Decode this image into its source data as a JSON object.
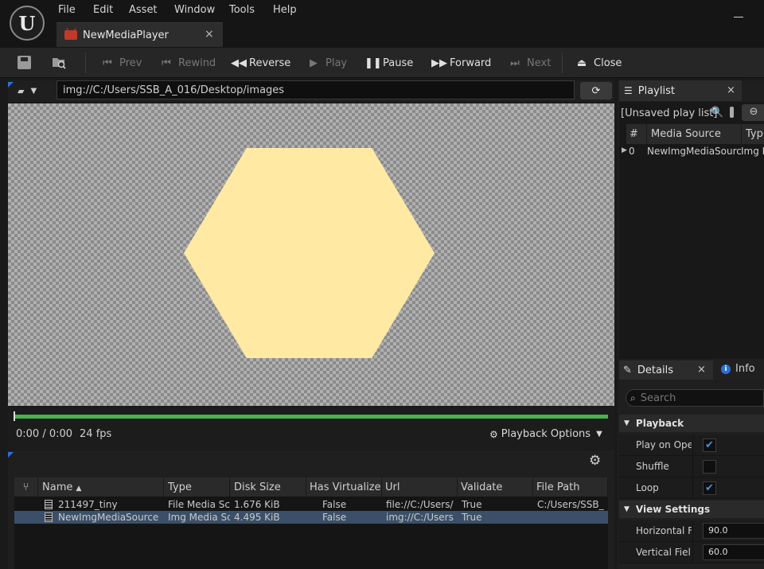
{
  "menu": [
    "File",
    "Edit",
    "Asset",
    "Window",
    "Tools",
    "Help"
  ],
  "doc_tab": {
    "title": "NewMediaPlayer",
    "close": "×"
  },
  "toolbar": {
    "prev": "Prev",
    "rewind": "Rewind",
    "reverse": "Reverse",
    "play": "Play",
    "pause": "Pause",
    "forward": "Forward",
    "next": "Next",
    "close": "Close"
  },
  "url": {
    "value": "img://C:/Users/SSB_A_016/Desktop/images"
  },
  "player": {
    "time": "0:00 / 0:00",
    "fps": "24 fps",
    "playback_options": "Playback Options",
    "progress": 0.0
  },
  "table": {
    "columns": [
      "Name",
      "Type",
      "Disk Size",
      "Has Virtualized",
      "Url",
      "Validate",
      "File Path"
    ],
    "rows": [
      {
        "name": "211497_tiny",
        "type": "File Media Sc",
        "disk": "1.676 KiB",
        "virt": "False",
        "url": "file://C:/Users/",
        "validate": "True",
        "path": "C:/Users/SSB_"
      },
      {
        "name": "NewImgMediaSource",
        "type": "Img Media Sc",
        "disk": "4.495 KiB",
        "virt": "False",
        "url": "img://C:/Users",
        "validate": "True",
        "path": ""
      }
    ]
  },
  "playlist": {
    "tab": "Playlist",
    "name": "[Unsaved play list]",
    "columns": [
      "#",
      "Media Source",
      "Typ"
    ],
    "rows": [
      {
        "index": "0",
        "source": "NewImgMediaSource",
        "type": "Img I"
      }
    ]
  },
  "details": {
    "tab": "Details",
    "info_tab": "Info",
    "search_placeholder": "Search",
    "playback_section": "Playback",
    "play_on_open": "Play on Open",
    "shuffle": "Shuffle",
    "loop": "Loop",
    "view_section": "View Settings",
    "hfov_label": "Horizontal Fi...",
    "hfov_value": "90.0",
    "vfov_label": "Vertical Fiel...",
    "vfov_value": "60.0",
    "play_on_open_checked": true,
    "shuffle_checked": false,
    "loop_checked": true
  },
  "colors": {
    "accent": "#2d6fd2",
    "progress": "#4caf50",
    "hexagon": "#ffe9a3",
    "selected_row": "#3b5068"
  }
}
